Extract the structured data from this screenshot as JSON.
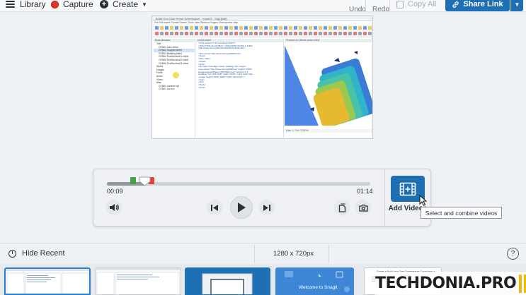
{
  "toolbar": {
    "library_label": "Library",
    "capture_label": "Capture",
    "create_label": "Create",
    "undo_label": "Undo",
    "redo_label": "Redo",
    "copy_all_label": "Copy All",
    "share_link_label": "Share Link"
  },
  "capture_preview": {
    "window_title": "Build Your Own Home Screensaver - mod4.5 - Sigil [edit]",
    "menu_text": "File  Edit  Insert  Format  Search  Tools  View  Window  Plugins  Checkpoints  Help",
    "book_browser_title": "Book Browser",
    "files": [
      "Text",
      "CEN01 Intro.xhtml",
      "CEN02 Chapter.xhtml",
      "CEN03 Building.xhtml",
      "CEN04 TextSection01.xhtml",
      "CEN05 TextSection02.xhtml",
      "CEN06 TextSection03.xhtml",
      "Styles",
      "Images",
      "Fonts",
      "Audio",
      "Video",
      "Misc",
      "CEN01 content.opf",
      "CEN01 toc.ncx"
    ],
    "editor_tab": "cen04.xhtml",
    "code_lines": [
      "<?xml version=\"1.0\" encoding=\"utf-8\"?>",
      "<!DOCTYPE html PUBLIC \"-//W3C//DTD XHTML 1.1//EN\"",
      "  \"http://www.w3.org/TR/xhtml11/DTD/xhtml11.dtd\">",
      "",
      "<html xmlns=\"http://www.w3.org/1999/xhtml\">",
      "<head>",
      "  <title></title>",
      "</head>",
      "<body>",
      "  <div style=\"text-align: center; padding: 0pt; margin:",
      "    <svg xmlns=\"http://www.w3.org/2000/svg\" height=\"100%\"",
      "      preserveAspectRatio=\"xMidYMid meet\" version=\"1.1\"",
      "      viewBox=\"0 0 1049 1600\" width=\"100%\" xmlns:xlink=\"http:",
      "      <image height=\"1600\" width=\"1049\" xlink:href=\"../",
      "    </svg>",
      "  </div>",
      "</body>",
      "</html>"
    ],
    "preview_panel_title": "Preview of CEN04 cover.xhtml",
    "status_text": "Line: 1, Col: 0   100%"
  },
  "player": {
    "progress_fraction": 0.144,
    "trim_start_fraction": 0.1,
    "trim_end_fraction": 0.17,
    "current_time": "00:09",
    "total_time": "01:14",
    "add_videos_label": "Add Videos",
    "tooltip_text": "Select and combine videos"
  },
  "recent_bar": {
    "hide_recent_label": "Hide Recent",
    "dimensions_text": "1280 x 720px",
    "help_label": "?"
  },
  "thumbnails": {
    "welcome_text": "Welcome to Snagit",
    "doc_title": "Create a Build Your Own Screensaver Cover from a Template"
  },
  "watermark": {
    "text": "TECHDONIA.PRO"
  },
  "colors": {
    "accent_blue": "#1f6fb4",
    "capture_red": "#e5342b",
    "trim_green": "#46a045",
    "trim_red": "#d9433b",
    "watermark_yellow": "#f3b705"
  },
  "icons": [
    "hamburger-icon",
    "capture-record-icon",
    "plus-circle-icon",
    "copy-icon",
    "link-icon",
    "volume-icon",
    "skip-back-icon",
    "play-icon",
    "skip-forward-icon",
    "copy-frame-icon",
    "camera-icon",
    "film-add-icon",
    "clock-icon",
    "help-icon"
  ]
}
